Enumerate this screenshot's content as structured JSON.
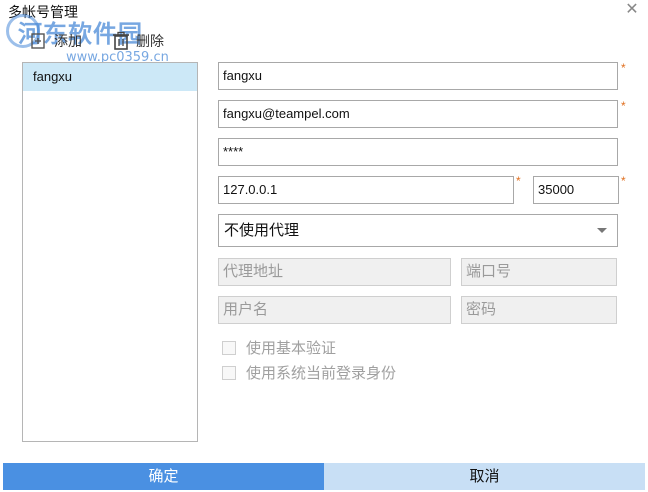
{
  "window": {
    "title": "多帐号管理",
    "close_glyph": "✕"
  },
  "toolbar": {
    "add_label": "添加",
    "delete_label": "删除"
  },
  "watermark": {
    "main": "河东软件园",
    "sub": "www.pc0359.cn"
  },
  "accounts": {
    "items": [
      {
        "label": "fangxu",
        "selected": true
      }
    ]
  },
  "form": {
    "username": "fangxu",
    "email": "fangxu@teampel.com",
    "password": "****",
    "server": "127.0.0.1",
    "port": "35000",
    "required_mark": "*",
    "proxy_select": {
      "value": "不使用代理"
    },
    "proxy_address": {
      "placeholder": "代理地址"
    },
    "proxy_port": {
      "placeholder": "端口号"
    },
    "proxy_user": {
      "placeholder": "用户名"
    },
    "proxy_password": {
      "placeholder": "密码"
    },
    "checkbox_basic_auth": {
      "label": "使用基本验证",
      "checked": false
    },
    "checkbox_system_identity": {
      "label": "使用系统当前登录身份",
      "checked": false
    }
  },
  "footer": {
    "ok_label": "确定",
    "cancel_label": "取消"
  },
  "colors": {
    "ok_bg": "#4a90e2",
    "cancel_bg": "#c8dff5",
    "selected_row": "#cce8f7",
    "required": "#e07020"
  }
}
